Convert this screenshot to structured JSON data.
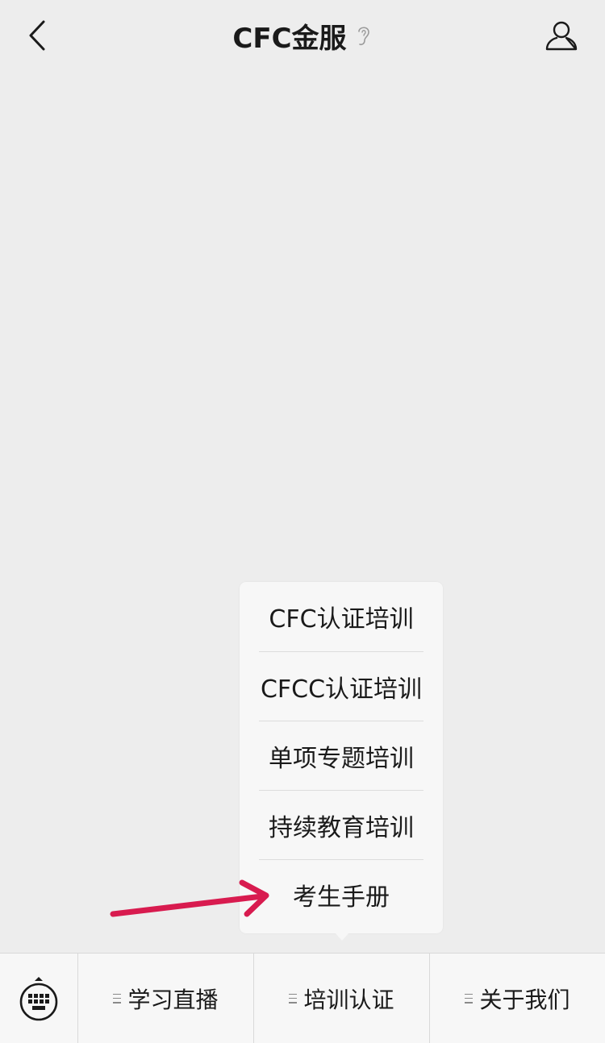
{
  "header": {
    "title": "CFC金服",
    "back_icon": "chevron-left-icon",
    "ear_icon": "ear-icon",
    "profile_icon": "user-icon"
  },
  "popup_menu": {
    "items": [
      {
        "label": "CFC认证培训"
      },
      {
        "label": "CFCC认证培训"
      },
      {
        "label": "单项专题培训"
      },
      {
        "label": "持续教育培训"
      },
      {
        "label": "考生手册"
      }
    ]
  },
  "annotation": {
    "arrow_color": "#d81b4f"
  },
  "bottom_bar": {
    "keyboard_icon": "keyboard-icon",
    "tabs": [
      {
        "label": "学习直播"
      },
      {
        "label": "培训认证"
      },
      {
        "label": "关于我们"
      }
    ]
  }
}
